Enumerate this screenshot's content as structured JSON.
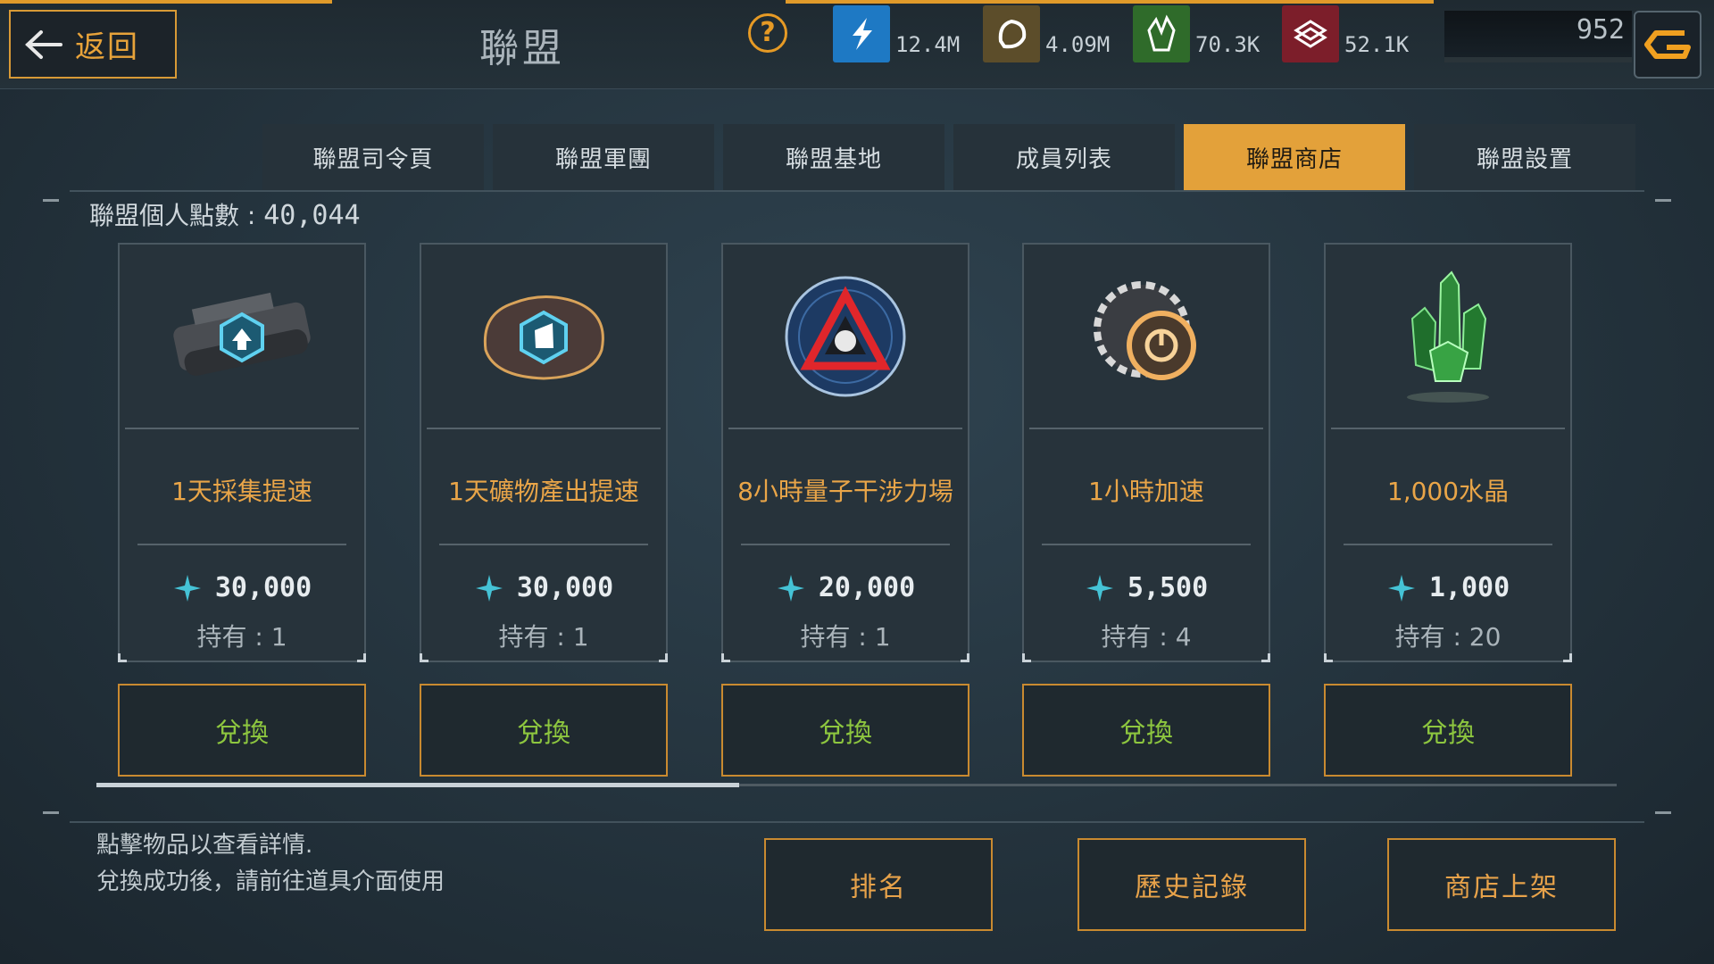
{
  "header": {
    "back_label": "返回",
    "title": "聯盟",
    "help_icon": "question-icon",
    "resources": [
      {
        "icon": "energy-icon",
        "value": "12.4M",
        "color": "#1e79c4"
      },
      {
        "icon": "ore-icon",
        "value": "4.09M",
        "color": "#5c4d2a"
      },
      {
        "icon": "crystal-icon",
        "value": "70.3K",
        "color": "#2f6b2a"
      },
      {
        "icon": "alloy-icon",
        "value": "52.1K",
        "color": "#7c1e2a"
      }
    ],
    "energy_value": "952",
    "accent_color": "#e3a13a"
  },
  "tabs": [
    {
      "label": "聯盟司令頁",
      "active": false
    },
    {
      "label": "聯盟軍團",
      "active": false
    },
    {
      "label": "聯盟基地",
      "active": false
    },
    {
      "label": "成員列表",
      "active": false
    },
    {
      "label": "聯盟商店",
      "active": true
    },
    {
      "label": "聯盟設置",
      "active": false
    }
  ],
  "points": {
    "label": "聯盟個人點數 : ",
    "value": "40,044"
  },
  "items": [
    {
      "name": "1天採集提速",
      "price": "30,000",
      "owned": "持有 : 1",
      "icon": "gather-speedup-icon"
    },
    {
      "name": "1天礦物產出提速",
      "price": "30,000",
      "owned": "持有 : 1",
      "icon": "mineral-boost-icon"
    },
    {
      "name": "8小時量子干涉力場",
      "price": "20,000",
      "owned": "持有 : 1",
      "icon": "quantum-shield-icon"
    },
    {
      "name": "1小時加速",
      "price": "5,500",
      "owned": "持有 : 4",
      "icon": "speedup-gear-icon"
    },
    {
      "name": "1,000水晶",
      "price": "1,000",
      "owned": "持有 : 20",
      "icon": "green-crystal-icon"
    }
  ],
  "redeem_label": "兌換",
  "currency_icon": "alliance-point-icon",
  "scroll_position": 0.42,
  "tips": [
    "點擊物品以查看詳情.",
    "兌換成功後，請前往道具介面使用"
  ],
  "bottom_buttons": [
    "排名",
    "歷史記錄",
    "商店上架"
  ]
}
